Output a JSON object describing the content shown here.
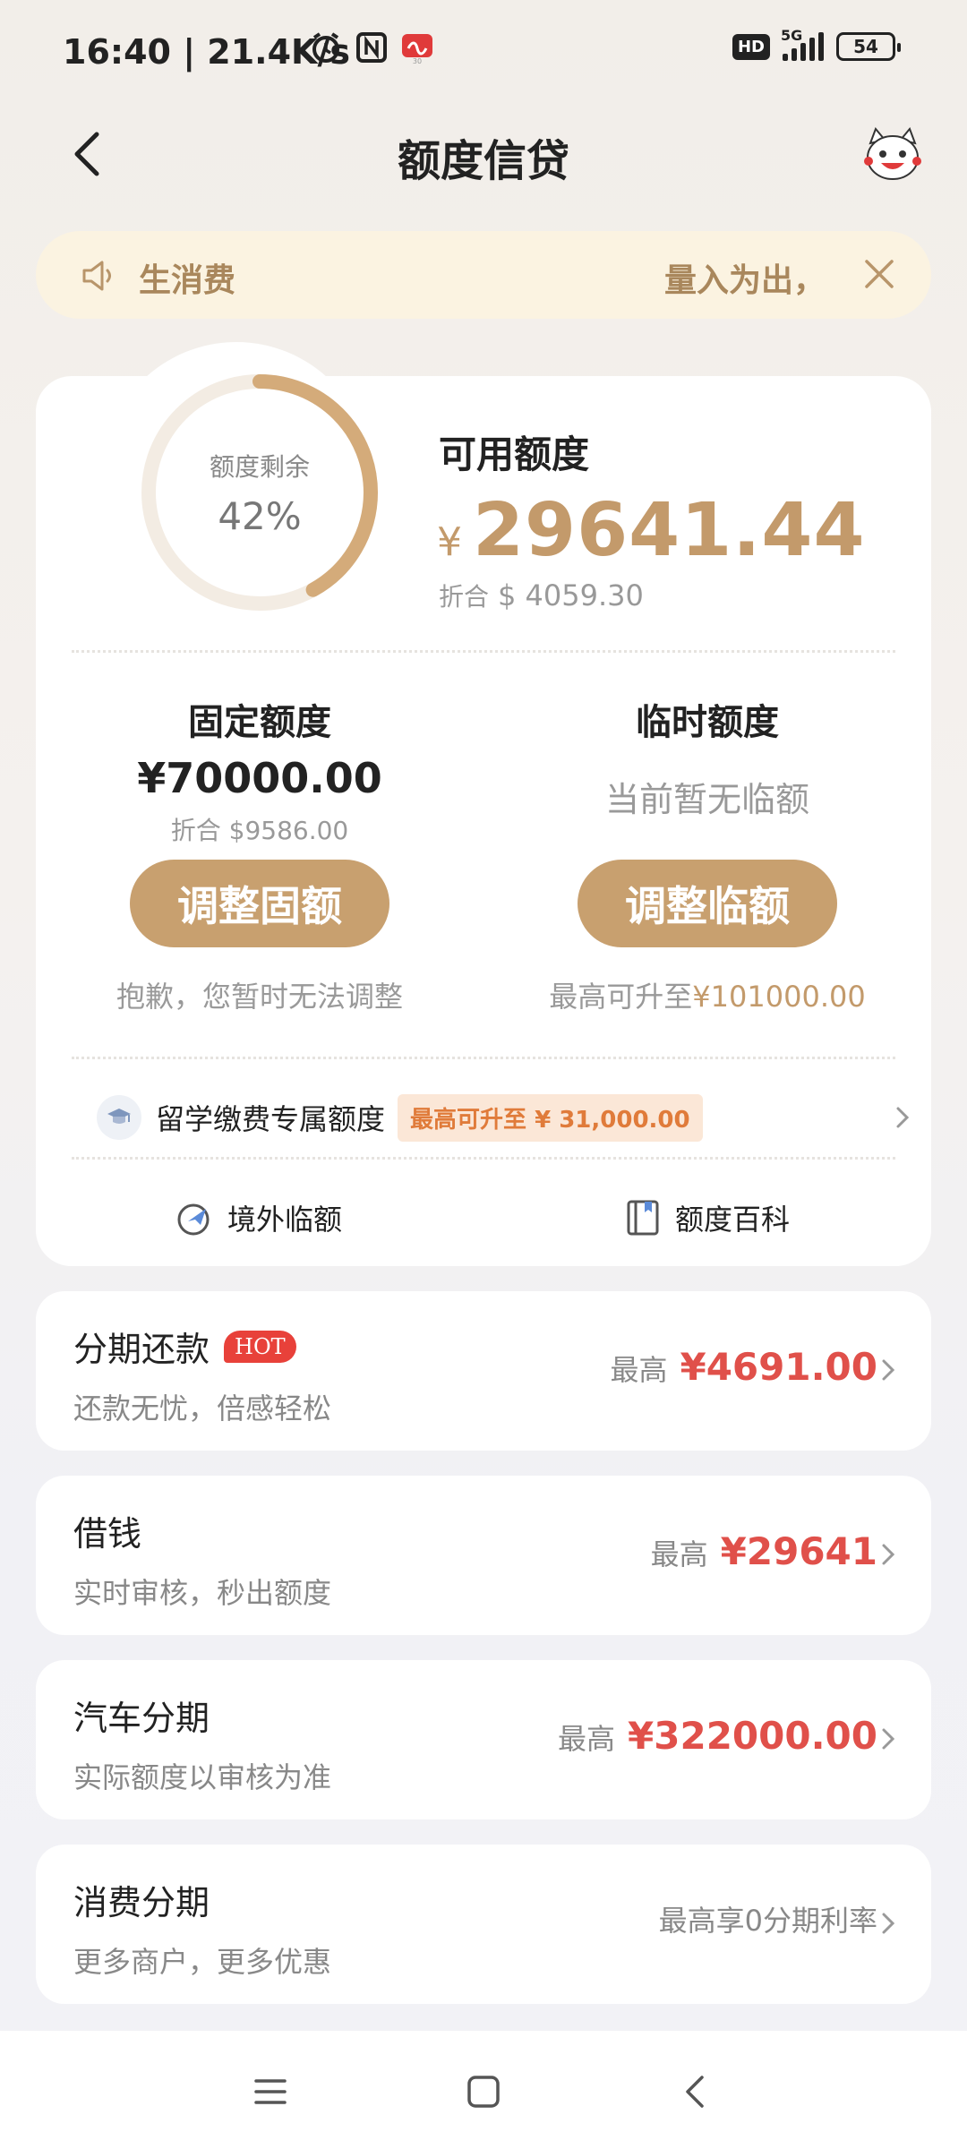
{
  "status_bar": {
    "time": "16:40 | 21.4K/s",
    "hd": "HD",
    "network": "5G",
    "battery": "54"
  },
  "navbar": {
    "title": "额度信贷"
  },
  "notice": {
    "text_left": "生消费",
    "text_right": "量入为出，"
  },
  "credit": {
    "ring_label": "额度剩余",
    "ring_percent": "42%",
    "ring_fraction": 0.42,
    "available_title": "可用额度",
    "currency_symbol": "¥",
    "available_amount": "29641.44",
    "conversion_label": "折合",
    "available_usd": "$ 4059.30"
  },
  "fixed": {
    "title": "固定额度",
    "amount": "¥70000.00",
    "conversion": "折合 $9586.00",
    "button": "调整固额",
    "note": "抱歉，您暂时无法调整"
  },
  "temporary": {
    "title": "临时额度",
    "status": "当前暂无临额",
    "button": "调整临额",
    "note_prefix": "最高可升至",
    "note_amount": "¥101000.00"
  },
  "study": {
    "label": "留学缴费专属额度",
    "tag": "最高可升至 ¥ 31,000.00"
  },
  "quick_links": {
    "overseas": "境外临额",
    "encyclopedia": "额度百科"
  },
  "products": [
    {
      "title": "分期还款",
      "hot": "HOT",
      "sub": "还款无忧，倍感轻松",
      "prefix": "最高",
      "value": "¥4691.00"
    },
    {
      "title": "借钱",
      "sub": "实时审核，秒出额度",
      "prefix": "最高",
      "value": "¥29641"
    },
    {
      "title": "汽车分期",
      "sub": "实际额度以审核为准",
      "prefix": "最高",
      "value": "¥322000.00"
    },
    {
      "title": "消费分期",
      "sub": "更多商户，更多优惠",
      "text": "最高享0分期利率"
    }
  ],
  "colors": {
    "gold": "#c8a06f",
    "red": "#e0504a"
  }
}
